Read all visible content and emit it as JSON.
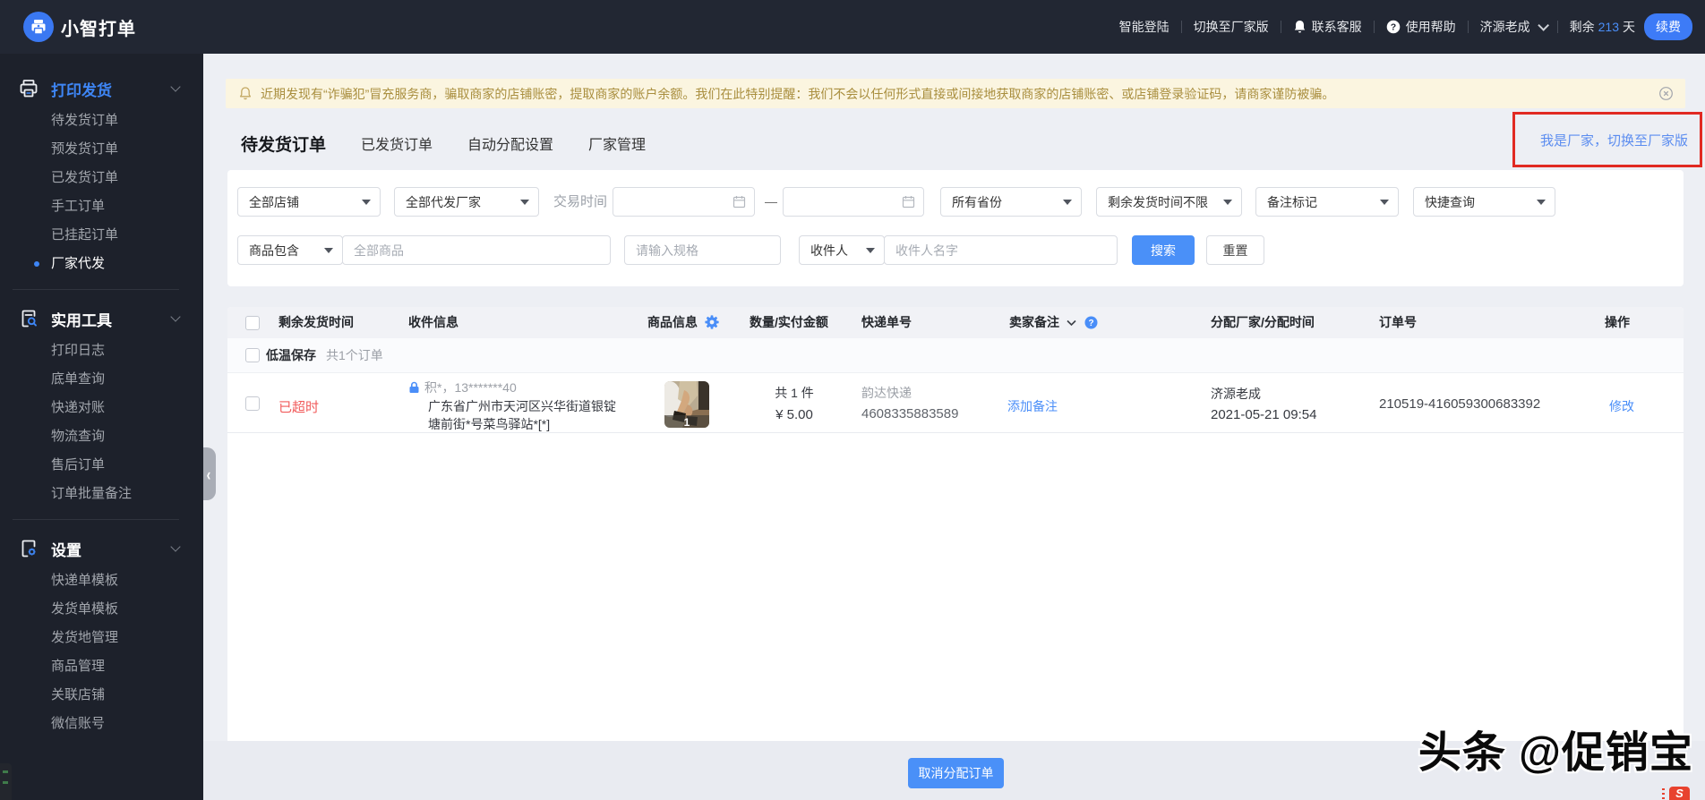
{
  "topbar": {
    "brand": "小智打单",
    "nav": [
      {
        "label": "智能登陆"
      },
      {
        "label": "切换至厂家版"
      },
      {
        "label": "联系客服",
        "icon": "bell-icon"
      },
      {
        "label": "使用帮助",
        "icon": "question-circle-icon"
      }
    ],
    "user": "济源老成",
    "remain_prefix": "剩余",
    "remain_days": "213",
    "remain_suffix": "天",
    "renew_label": "续费"
  },
  "sidebar": {
    "sections": [
      {
        "title": "打印发货",
        "icon": "printer-icon",
        "items": [
          "待发货订单",
          "预发货订单",
          "已发货订单",
          "手工订单",
          "已挂起订单",
          "厂家代发"
        ],
        "selected": "厂家代发"
      },
      {
        "title": "实用工具",
        "icon": "tools-icon",
        "items": [
          "打印日志",
          "底单查询",
          "快递对账",
          "物流查询",
          "售后订单",
          "订单批量备注"
        ]
      },
      {
        "title": "设置",
        "icon": "gear-doc-icon",
        "items": [
          "快递单模板",
          "发货单模板",
          "发货地管理",
          "商品管理",
          "关联店铺",
          "微信账号"
        ]
      }
    ]
  },
  "notice": {
    "text": "近期发现有“诈骗犯”冒充服务商，骗取商家的店铺账密，提取商家的账户余额。我们在此特别提醒：我们不会以任何形式直接或间接地获取商家的店铺账密、或店铺登录验证码，请商家谨防被骗。"
  },
  "tabs": [
    "待发货订单",
    "已发货订单",
    "自动分配设置",
    "厂家管理"
  ],
  "active_tab": "待发货订单",
  "switch_link": "我是厂家，切换至厂家版",
  "filters": {
    "shop": "全部店铺",
    "factory": "全部代发厂家",
    "trade_time_label": "交易时间",
    "dash": "—",
    "province": "所有省份",
    "remaining_time": "剩余发货时间不限",
    "remark_mark": "备注标记",
    "quick_query": "快捷查询",
    "product_contains": "商品包含",
    "product_placeholder": "全部商品",
    "spec_placeholder": "请输入规格",
    "receiver": "收件人",
    "receiver_placeholder": "收件人名字",
    "search_label": "搜索",
    "reset_label": "重置"
  },
  "table": {
    "columns": [
      "剩余发货时间",
      "收件信息",
      "商品信息",
      "数量/实付金额",
      "快递单号",
      "卖家备注",
      "分配厂家/分配时间",
      "订单号",
      "操作"
    ],
    "group": {
      "tag": "低温保存",
      "count": "共1个订单"
    },
    "order": {
      "status": "已超时",
      "buyer": "积*，13*******40",
      "address": "广东省广州市天河区兴华街道银锭塘前街*号菜鸟驿站*[*]",
      "thumb_badge": "1",
      "qty": "共 1 件",
      "amount": "¥ 5.00",
      "courier": "韵达快递",
      "tracking_no": "4608335883589",
      "add_remark": "添加备注",
      "factory": "济源老成",
      "assign_time": "2021-05-21 09:54",
      "order_no": "210519-416059300683392",
      "action": "修改"
    }
  },
  "footer": {
    "cancel_label": "取消分配订单"
  },
  "watermark": "头条 @促销宝",
  "mini_logo_glyph": "S",
  "colors": {
    "accent": "#4a8ef8",
    "danger": "#f15b5b",
    "notice_text": "#a98e3e",
    "annotation_red": "#e12a22"
  }
}
